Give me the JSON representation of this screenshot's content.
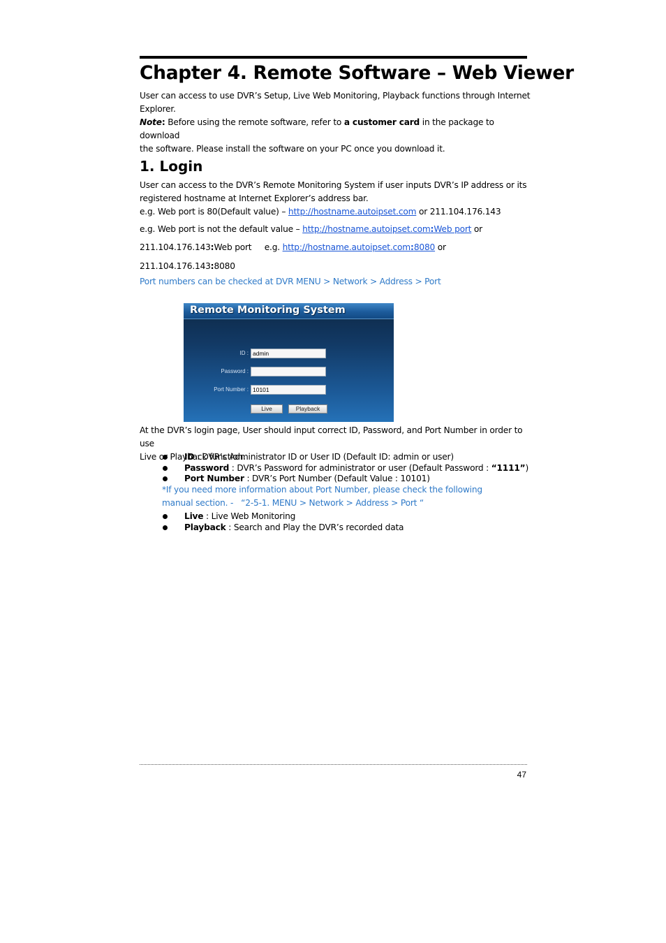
{
  "chapter_title": "Chapter 4. Remote Software – Web Viewer",
  "intro": {
    "line1": "User can access to use DVR’s Setup, Live Web Monitoring, Playback functions through Internet",
    "line2": "Explorer.",
    "note_label": "Note",
    "note_colon": ":",
    "note_text1": " Before using the remote software, refer to ",
    "note_bold": "a customer card",
    "note_text2": " in the package to download",
    "note_line2": "the software. Please install the software on your PC once you download it."
  },
  "section": {
    "title": "1. Login",
    "para_line1": "User can access to the DVR’s Remote Monitoring System if user inputs DVR’s IP address or its",
    "para_line2": "registered hostname at Internet Explorer’s address bar.",
    "eg1_prefix": "e.g. Web port is 80(Default value) – ",
    "eg1_link": "http://hostname.autoipset.com",
    "eg1_suffix": " or 211.104.176.143",
    "eg2_prefix": "e.g. Web port is not the default value – ",
    "eg2_link_host": "http://hostname.autoipset.com",
    "eg2_link_port": "Web port",
    "eg2_suffix": " or",
    "eg3_ip": "211.104.176.143",
    "eg3_port": "Web port",
    "eg3_mid": "     e.g. ",
    "eg3_link_host": "http://hostname.autoipset.com",
    "eg3_link_port": "8080",
    "eg3_suffix": " or",
    "eg4_ip": "211.104.176.143",
    "eg4_port": "8080",
    "separator": ":",
    "port_hint": "Port numbers can be checked at DVR MENU > Network > Address > Port"
  },
  "login_window": {
    "title": "Remote Monitoring System",
    "id_label": "ID :",
    "id_value": "admin",
    "password_label": "Password :",
    "password_value": "",
    "port_label": "Port Number :",
    "port_value": "10101",
    "live_button": "Live",
    "playback_button": "Playback"
  },
  "description": {
    "line1": "At the DVR’s login page, User should input correct ID, Password, and Port Number in order to use",
    "line2": "Live or Playback function."
  },
  "bullets_a": [
    {
      "term": "ID",
      "text": " : DVR’s Administrator ID or User ID (Default ID: admin or user)"
    },
    {
      "term": "Password",
      "text": " : DVR’s Password for administrator or user (Default Password : ",
      "bold_value": "“1111”",
      "tail": ")"
    },
    {
      "term": "Port Number",
      "text": " : DVR’s Port Number (Default Value : 10101)"
    }
  ],
  "port_note": {
    "line1": "*If you need more information about Port Number, please check the following",
    "line2": "manual section. -   “2-5-1. MENU > Network > Address > Port “"
  },
  "bullets_b": [
    {
      "term": "Live",
      "text": " : Live Web Monitoring"
    },
    {
      "term": "Playback",
      "text": " : Search and Play the DVR’s recorded data"
    }
  ],
  "footer": {
    "page_number": "47"
  }
}
